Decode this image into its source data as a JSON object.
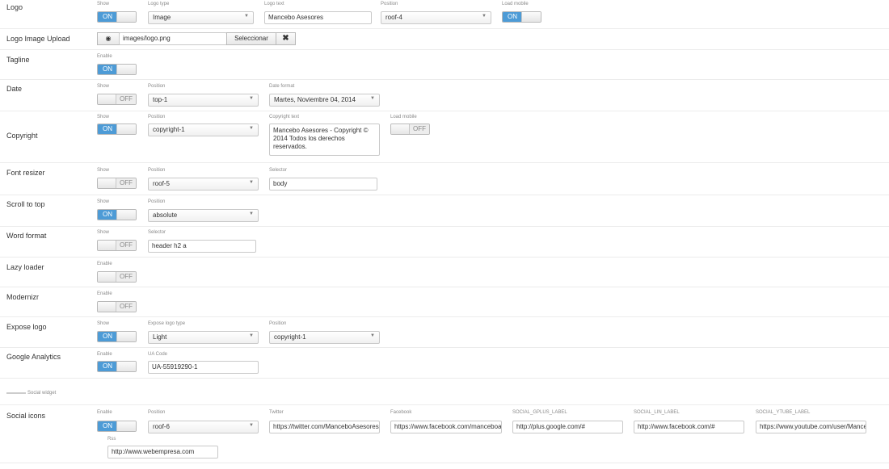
{
  "logo": {
    "label": "Logo",
    "show_label": "Show",
    "show_value": "ON",
    "type_label": "Logo type",
    "type_value": "Image",
    "text_label": "Logo text",
    "text_value": "Mancebo Asesores",
    "position_label": "Position",
    "position_value": "roof-4",
    "mobile_label": "Load mobile",
    "mobile_value": "ON"
  },
  "logo_upload": {
    "label": "Logo Image Upload",
    "path": "images/logo.png",
    "select_label": "Seleccionar",
    "clear_icon": "✖"
  },
  "tagline": {
    "label": "Tagline",
    "enable_label": "Enable",
    "enable_value": "ON"
  },
  "date": {
    "label": "Date",
    "show_label": "Show",
    "show_value": "OFF",
    "position_label": "Position",
    "position_value": "top-1",
    "format_label": "Date format",
    "format_value": "Martes, Noviembre 04, 2014"
  },
  "copyright": {
    "label": "Copyright",
    "show_label": "Show",
    "show_value": "ON",
    "position_label": "Position",
    "position_value": "copyright-1",
    "text_label": "Copyright text",
    "text_value": "Mancebo Asesores - Copyright © 2014 Todos los derechos reservados.",
    "mobile_label": "Load mobile",
    "mobile_value": "OFF"
  },
  "font_resizer": {
    "label": "Font resizer",
    "show_label": "Show",
    "show_value": "OFF",
    "position_label": "Position",
    "position_value": "roof-5",
    "selector_label": "Selector",
    "selector_value": "body"
  },
  "scroll_top": {
    "label": "Scroll to top",
    "show_label": "Show",
    "show_value": "ON",
    "position_label": "Position",
    "position_value": "absolute"
  },
  "word_format": {
    "label": "Word format",
    "show_label": "Show",
    "show_value": "OFF",
    "selector_label": "Selector",
    "selector_value": "header h2 a"
  },
  "lazy_loader": {
    "label": "Lazy loader",
    "enable_label": "Enable",
    "enable_value": "OFF"
  },
  "modernizr": {
    "label": "Modernizr",
    "enable_label": "Enable",
    "enable_value": "OFF"
  },
  "expose_logo": {
    "label": "Expose logo",
    "show_label": "Show",
    "show_value": "ON",
    "type_label": "Expose logo type",
    "type_value": "Light",
    "position_label": "Position",
    "position_value": "copyright-1"
  },
  "analytics": {
    "label": "Google Analytics",
    "enable_label": "Enable",
    "enable_value": "ON",
    "code_label": "UA Code",
    "code_value": "UA-55919290-1"
  },
  "social_widget": {
    "label": "Social widget"
  },
  "social_icons": {
    "label": "Social icons",
    "enable_label": "Enable",
    "enable_value": "ON",
    "position_label": "Position",
    "position_value": "roof-6",
    "twitter_label": "Twitter",
    "twitter_value": "https://twitter.com/ManceboAsesores",
    "facebook_label": "Facebook",
    "facebook_value": "https://www.facebook.com/manceboasesores",
    "gplus_label": "SOCIAL_GPLUS_LABEL",
    "gplus_value": "http://plus.google.com/#",
    "lin_label": "SOCIAL_LIN_LABEL",
    "lin_value": "http://www.facebook.com/#",
    "ytube_label": "SOCIAL_YTUBE_LABEL",
    "ytube_value": "https://www.youtube.com/user/ManceboAsesores",
    "rss_label": "Rss",
    "rss_value": "http://www.webempresa.com"
  }
}
